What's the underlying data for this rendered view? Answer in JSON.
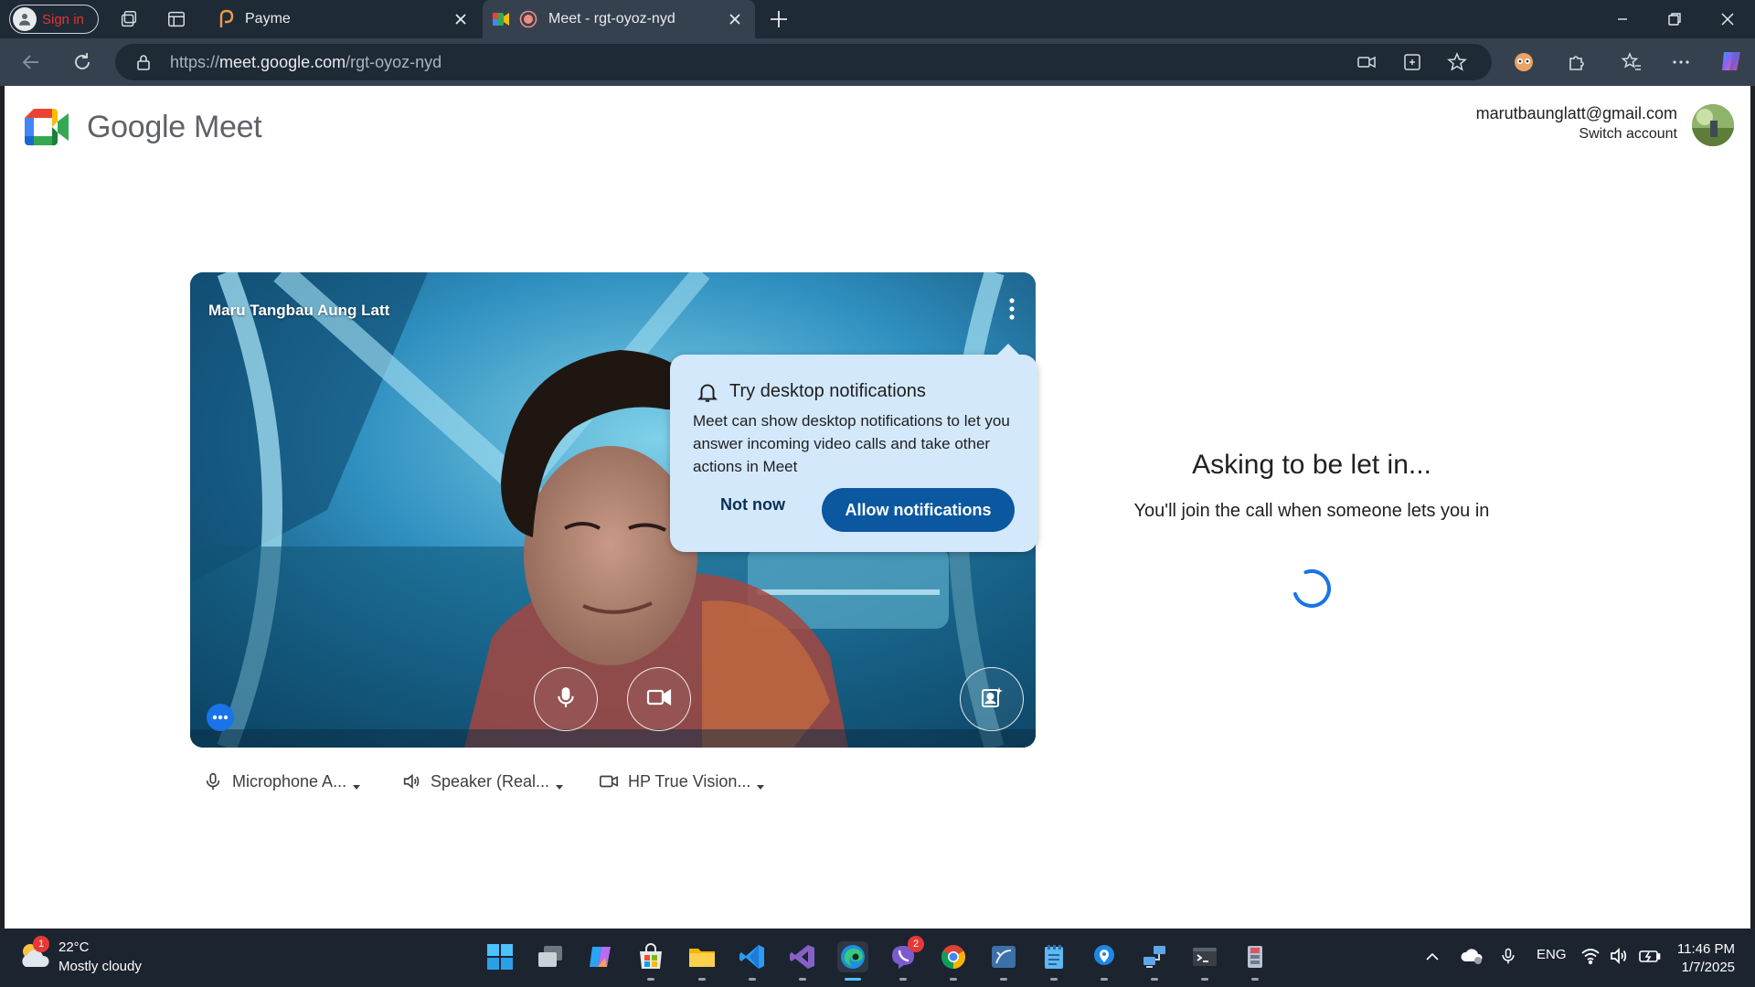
{
  "browser": {
    "profile_label": "Sign in",
    "tabs": [
      {
        "title": "Payme"
      },
      {
        "title": "Meet - rgt-oyoz-nyd"
      }
    ],
    "url": {
      "prefix": "https://",
      "host": "meet.google.com",
      "path": "/rgt-oyoz-nyd"
    }
  },
  "header": {
    "brand": "Google Meet",
    "account_email": "marutbaunglatt@gmail.com",
    "switch_account": "Switch account"
  },
  "video": {
    "participant_name": "Maru Tangbau Aung Latt"
  },
  "notification": {
    "title": "Try desktop notifications",
    "body": "Meet can show desktop notifications to let you answer incoming video calls and take other actions in Meet",
    "not_now": "Not now",
    "allow": "Allow notifications"
  },
  "devices": {
    "microphone": "Microphone A...",
    "speaker": "Speaker (Real...",
    "camera": "HP True Vision..."
  },
  "status": {
    "heading": "Asking to be let in...",
    "message": "You'll join the call when someone lets you in"
  },
  "taskbar": {
    "weather_badge": "1",
    "temperature": "22°C",
    "weather": "Mostly cloudy",
    "viber_badge": "2",
    "language": "ENG",
    "time": "11:46 PM",
    "date": "1/7/2025"
  },
  "colors": {
    "accent_blue": "#0b57a0",
    "popover_bg": "#d3e8fb",
    "spinner": "#1a73e8"
  }
}
